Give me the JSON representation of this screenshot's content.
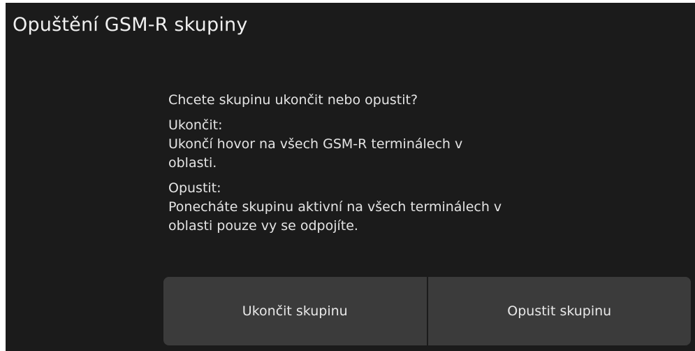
{
  "dialog": {
    "title": "Opuštění GSM-R skupiny",
    "question": "Chcete skupinu ukončit nebo opustit?",
    "end_heading": "Ukončit:",
    "end_line1": "Ukončí hovor na všech GSM-R terminálech v",
    "end_line2": "oblasti.",
    "leave_heading": "Opustit:",
    "leave_line1": "Ponecháte skupinu aktivní na všech terminálech v",
    "leave_line2": "oblasti pouze vy se odpojíte."
  },
  "buttons": {
    "end_label": "Ukončit skupinu",
    "leave_label": "Opustit skupinu"
  },
  "colors": {
    "background": "#1b1b1b",
    "button": "#3b3b3b",
    "text": "#e6e6e6"
  }
}
